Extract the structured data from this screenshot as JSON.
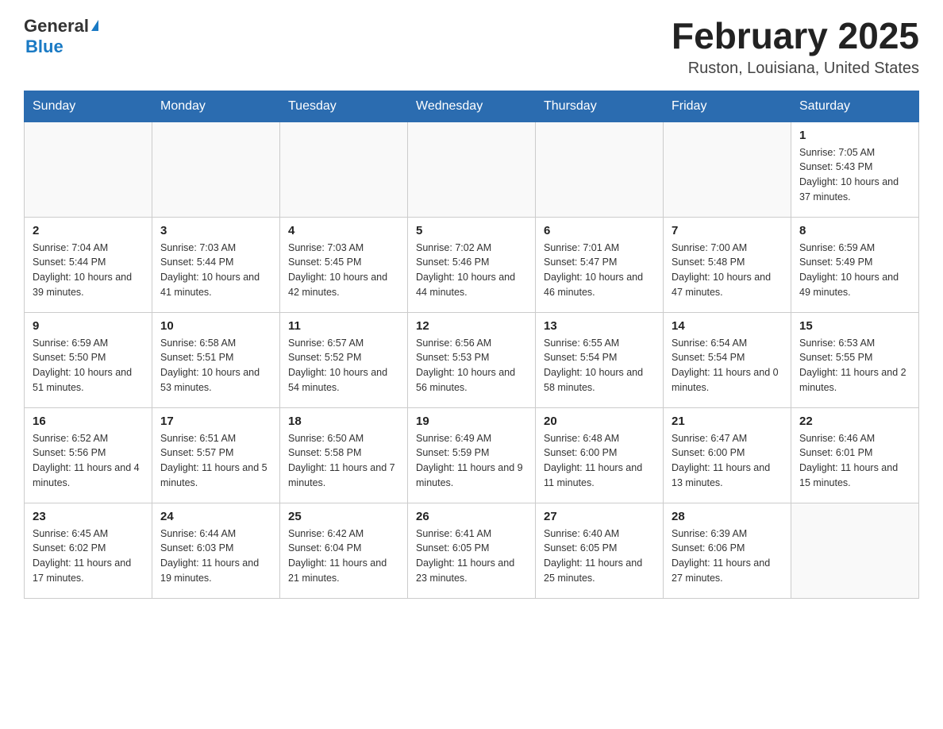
{
  "header": {
    "logo": {
      "general": "General",
      "blue": "Blue"
    },
    "title": "February 2025",
    "location": "Ruston, Louisiana, United States"
  },
  "days_of_week": [
    "Sunday",
    "Monday",
    "Tuesday",
    "Wednesday",
    "Thursday",
    "Friday",
    "Saturday"
  ],
  "weeks": [
    [
      {
        "day": "",
        "info": ""
      },
      {
        "day": "",
        "info": ""
      },
      {
        "day": "",
        "info": ""
      },
      {
        "day": "",
        "info": ""
      },
      {
        "day": "",
        "info": ""
      },
      {
        "day": "",
        "info": ""
      },
      {
        "day": "1",
        "info": "Sunrise: 7:05 AM\nSunset: 5:43 PM\nDaylight: 10 hours and 37 minutes."
      }
    ],
    [
      {
        "day": "2",
        "info": "Sunrise: 7:04 AM\nSunset: 5:44 PM\nDaylight: 10 hours and 39 minutes."
      },
      {
        "day": "3",
        "info": "Sunrise: 7:03 AM\nSunset: 5:44 PM\nDaylight: 10 hours and 41 minutes."
      },
      {
        "day": "4",
        "info": "Sunrise: 7:03 AM\nSunset: 5:45 PM\nDaylight: 10 hours and 42 minutes."
      },
      {
        "day": "5",
        "info": "Sunrise: 7:02 AM\nSunset: 5:46 PM\nDaylight: 10 hours and 44 minutes."
      },
      {
        "day": "6",
        "info": "Sunrise: 7:01 AM\nSunset: 5:47 PM\nDaylight: 10 hours and 46 minutes."
      },
      {
        "day": "7",
        "info": "Sunrise: 7:00 AM\nSunset: 5:48 PM\nDaylight: 10 hours and 47 minutes."
      },
      {
        "day": "8",
        "info": "Sunrise: 6:59 AM\nSunset: 5:49 PM\nDaylight: 10 hours and 49 minutes."
      }
    ],
    [
      {
        "day": "9",
        "info": "Sunrise: 6:59 AM\nSunset: 5:50 PM\nDaylight: 10 hours and 51 minutes."
      },
      {
        "day": "10",
        "info": "Sunrise: 6:58 AM\nSunset: 5:51 PM\nDaylight: 10 hours and 53 minutes."
      },
      {
        "day": "11",
        "info": "Sunrise: 6:57 AM\nSunset: 5:52 PM\nDaylight: 10 hours and 54 minutes."
      },
      {
        "day": "12",
        "info": "Sunrise: 6:56 AM\nSunset: 5:53 PM\nDaylight: 10 hours and 56 minutes."
      },
      {
        "day": "13",
        "info": "Sunrise: 6:55 AM\nSunset: 5:54 PM\nDaylight: 10 hours and 58 minutes."
      },
      {
        "day": "14",
        "info": "Sunrise: 6:54 AM\nSunset: 5:54 PM\nDaylight: 11 hours and 0 minutes."
      },
      {
        "day": "15",
        "info": "Sunrise: 6:53 AM\nSunset: 5:55 PM\nDaylight: 11 hours and 2 minutes."
      }
    ],
    [
      {
        "day": "16",
        "info": "Sunrise: 6:52 AM\nSunset: 5:56 PM\nDaylight: 11 hours and 4 minutes."
      },
      {
        "day": "17",
        "info": "Sunrise: 6:51 AM\nSunset: 5:57 PM\nDaylight: 11 hours and 5 minutes."
      },
      {
        "day": "18",
        "info": "Sunrise: 6:50 AM\nSunset: 5:58 PM\nDaylight: 11 hours and 7 minutes."
      },
      {
        "day": "19",
        "info": "Sunrise: 6:49 AM\nSunset: 5:59 PM\nDaylight: 11 hours and 9 minutes."
      },
      {
        "day": "20",
        "info": "Sunrise: 6:48 AM\nSunset: 6:00 PM\nDaylight: 11 hours and 11 minutes."
      },
      {
        "day": "21",
        "info": "Sunrise: 6:47 AM\nSunset: 6:00 PM\nDaylight: 11 hours and 13 minutes."
      },
      {
        "day": "22",
        "info": "Sunrise: 6:46 AM\nSunset: 6:01 PM\nDaylight: 11 hours and 15 minutes."
      }
    ],
    [
      {
        "day": "23",
        "info": "Sunrise: 6:45 AM\nSunset: 6:02 PM\nDaylight: 11 hours and 17 minutes."
      },
      {
        "day": "24",
        "info": "Sunrise: 6:44 AM\nSunset: 6:03 PM\nDaylight: 11 hours and 19 minutes."
      },
      {
        "day": "25",
        "info": "Sunrise: 6:42 AM\nSunset: 6:04 PM\nDaylight: 11 hours and 21 minutes."
      },
      {
        "day": "26",
        "info": "Sunrise: 6:41 AM\nSunset: 6:05 PM\nDaylight: 11 hours and 23 minutes."
      },
      {
        "day": "27",
        "info": "Sunrise: 6:40 AM\nSunset: 6:05 PM\nDaylight: 11 hours and 25 minutes."
      },
      {
        "day": "28",
        "info": "Sunrise: 6:39 AM\nSunset: 6:06 PM\nDaylight: 11 hours and 27 minutes."
      },
      {
        "day": "",
        "info": ""
      }
    ]
  ]
}
